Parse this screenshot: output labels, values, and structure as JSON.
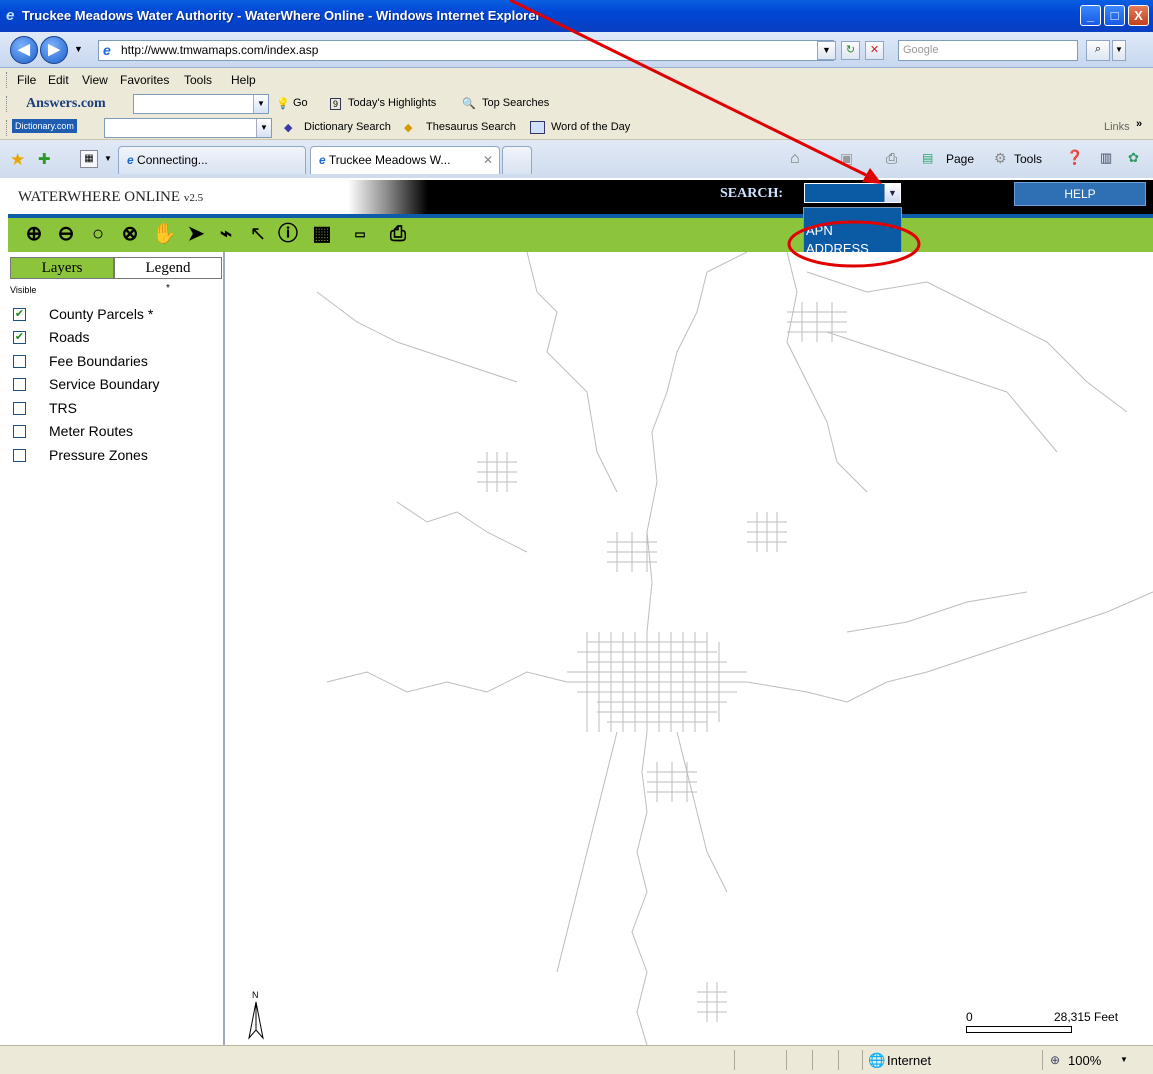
{
  "window": {
    "title": "Truckee Meadows Water Authority - WaterWhere Online - Windows Internet Explorer",
    "minimize_label": "_",
    "maximize_label": "□",
    "close_label": "X"
  },
  "address_bar": {
    "url": "http://www.tmwamaps.com/index.asp",
    "search_placeholder": "Google",
    "refresh_glyph": "↻",
    "stop_glyph": "✕"
  },
  "menu": {
    "items": [
      "File",
      "Edit",
      "View",
      "Favorites",
      "Tools",
      "Help"
    ]
  },
  "answers_toolbar": {
    "brand": "Answers.com",
    "go_label": "Go",
    "highlights_label": "Today's Highlights",
    "top_searches_label": "Top Searches"
  },
  "dictionary_toolbar": {
    "brand": "Dictionary.com",
    "dictionary_search_label": "Dictionary Search",
    "thesaurus_search_label": "Thesaurus Search",
    "word_of_day_label": "Word of the Day",
    "links_label": "Links"
  },
  "tabs": [
    {
      "label": "Connecting..."
    },
    {
      "label": "Truckee Meadows W..."
    }
  ],
  "command_bar": {
    "page_label": "Page",
    "tools_label": "Tools"
  },
  "app": {
    "logo_text": "WATERWHERE ONLINE",
    "version": "v2.5",
    "search_label": "SEARCH:",
    "help_label": "HELP",
    "search_options": [
      "APN",
      "ADDRESS"
    ]
  },
  "panel": {
    "tab_layers": "Layers",
    "tab_legend": "Legend",
    "visible_header": "Visible",
    "star_header": "*",
    "layers": [
      {
        "label": "County Parcels *",
        "checked": true
      },
      {
        "label": "Roads",
        "checked": true
      },
      {
        "label": "Fee Boundaries",
        "checked": false
      },
      {
        "label": "Service Boundary",
        "checked": false
      },
      {
        "label": "TRS",
        "checked": false
      },
      {
        "label": "Meter Routes",
        "checked": false
      },
      {
        "label": "Pressure Zones",
        "checked": false
      }
    ]
  },
  "map": {
    "north_label": "N",
    "scale_zero": "0",
    "scale_end": "28,315 Feet"
  },
  "status": {
    "zone_label": "Internet",
    "zoom_label": "100%"
  },
  "colors": {
    "accent_green": "#8cc43c",
    "header_black": "#000000",
    "select_blue": "#0b5aa4",
    "annotation_red": "#e00000"
  }
}
